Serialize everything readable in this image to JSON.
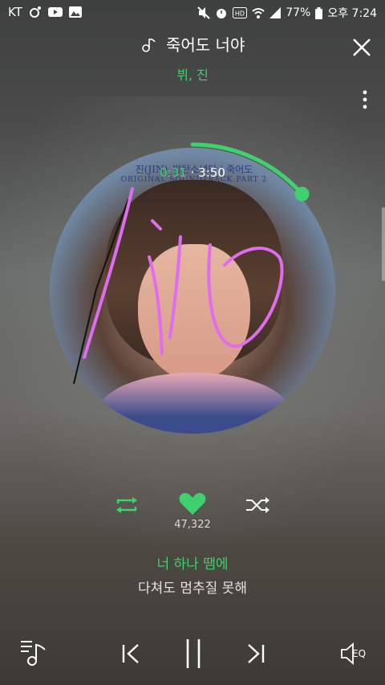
{
  "status": {
    "carrier": "KT",
    "battery": "77%",
    "time": "오후 7:24",
    "icons": [
      "kakaotalk-icon",
      "youtube-icon",
      "gallery-icon",
      "mute-icon",
      "alarm-icon",
      "hd-icon",
      "wifi-icon",
      "signal-icon",
      "battery-icon"
    ]
  },
  "song": {
    "title": "죽어도 너야",
    "artist": "뷔, 진",
    "title_icon": "music-note-icon"
  },
  "player": {
    "current_time": "0:31",
    "separator": "·",
    "duration": "3:50",
    "progress_fraction": 0.135,
    "likes": "47,322",
    "accent": "#3fd16e"
  },
  "album": {
    "ost_line1": "진(JIN)_방탄소년단 | 죽어도",
    "ost_line2": "ORIGINAL SOUNDTRACK PART 2"
  },
  "lyrics": {
    "current": "너 하나 땜에",
    "next": "다쳐도 멈추질 못해"
  },
  "annotation": {
    "handwritten_text": "1:10",
    "stroke_color": "#e06cf0"
  },
  "controls": [
    "playlist-icon",
    "previous-icon",
    "pause-icon",
    "next-icon",
    "eq-icon"
  ],
  "eq_label": "EQ"
}
